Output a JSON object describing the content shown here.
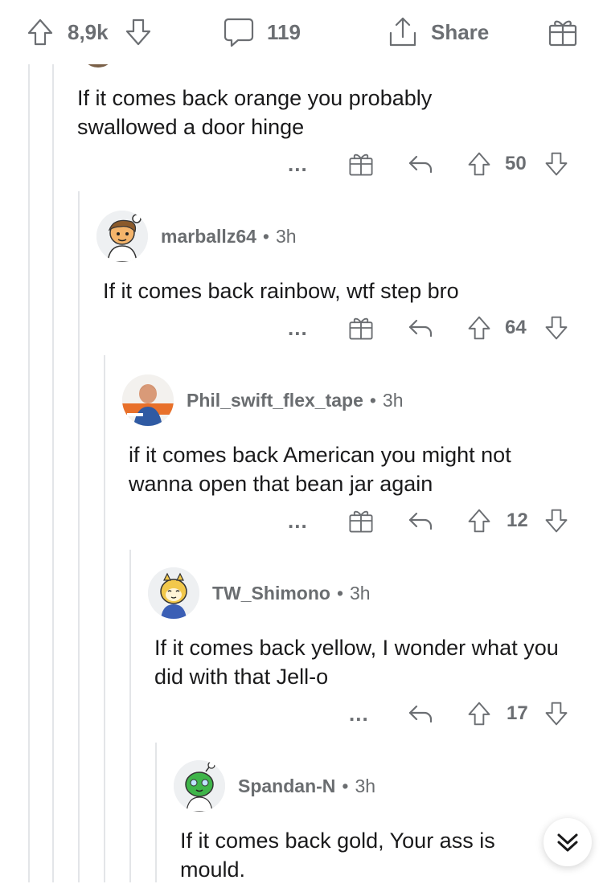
{
  "post_bar": {
    "upvotes": "8,9k",
    "comments": "119",
    "share_label": "Share"
  },
  "comments": [
    {
      "author": "",
      "age": "",
      "body": "If it comes back orange you probably swallowed a door hinge",
      "votes": "50",
      "more": "..."
    },
    {
      "author": "marballz64",
      "age": "3h",
      "body": "If it comes back rainbow, wtf step bro",
      "votes": "64",
      "more": "..."
    },
    {
      "author": "Phil_swift_flex_tape",
      "age": "3h",
      "body": "if it comes back American you might not wanna open that bean jar again",
      "votes": "12",
      "more": "..."
    },
    {
      "author": "TW_Shimono",
      "age": "3h",
      "body": "If it comes back yellow, I wonder what you did with that Jell-o",
      "votes": "17",
      "more": "..."
    },
    {
      "author": "Spandan-N",
      "age": "3h",
      "body": "If it comes back gold, Your ass is mould.",
      "votes": "",
      "more": ""
    }
  ],
  "separator": "•",
  "icons": {
    "upvote": "arrow-up-icon",
    "downvote": "arrow-down-icon",
    "comment": "speech-bubble-icon",
    "share": "share-icon",
    "award": "gift-icon",
    "reply": "reply-arrow-icon",
    "scroll": "double-chevron-down-icon"
  }
}
